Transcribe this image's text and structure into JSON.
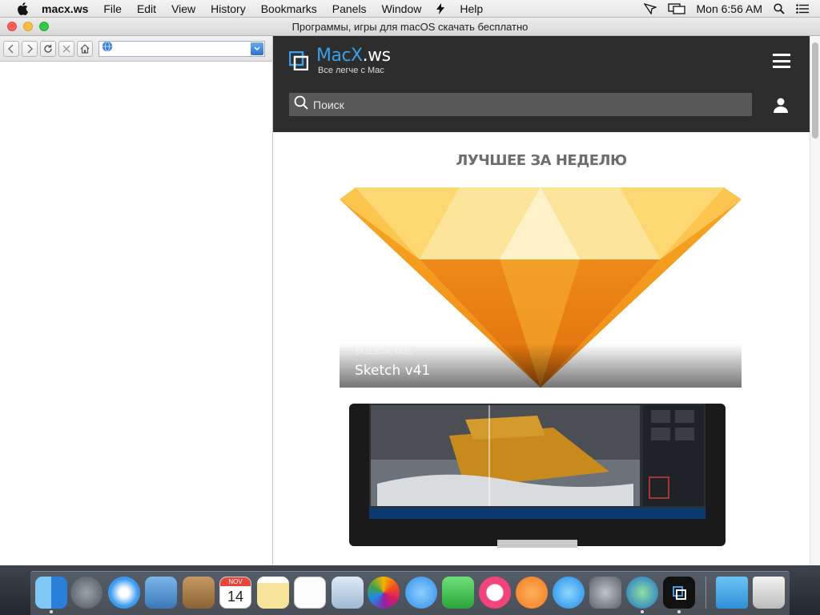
{
  "menubar": {
    "app_name": "macx.ws",
    "menus": [
      "File",
      "Edit",
      "View",
      "History",
      "Bookmarks",
      "Panels",
      "Window",
      "Help"
    ],
    "clock": "Mon 6:56 AM"
  },
  "window": {
    "title": "Программы, игры для macOS скачать бесплатно",
    "url_value": ""
  },
  "site": {
    "logo_title": "MacX",
    "logo_title_suffix": ".ws",
    "logo_subtitle": "Все легче с Mac",
    "search_placeholder": "Поиск",
    "section_title": "ЛУЧШЕЕ ЗА НЕДЕЛЮ",
    "cards": [
      {
        "title": "Sketch v41",
        "date": "13.11.2016, 18:11"
      },
      {
        "title": ""
      }
    ]
  },
  "dock": {
    "apps": [
      "finder-icon",
      "launchpad-icon",
      "safari-icon",
      "mail-icon",
      "contacts-icon",
      "calendar-icon",
      "notes-icon",
      "reminders-icon",
      "preview-icon",
      "photos-icon",
      "messages-icon",
      "facetime-icon",
      "itunes-icon",
      "ibooks-icon",
      "app-store-icon",
      "system-preferences-icon",
      "network-icon",
      "macx-icon",
      "folder-icon",
      "trash-icon"
    ],
    "calendar_month": "NOV",
    "calendar_day": "14"
  },
  "colors": {
    "brand_blue": "#3aa0e8",
    "header_bg": "#2d2d2d",
    "sketch_orange": "#f5a623"
  }
}
